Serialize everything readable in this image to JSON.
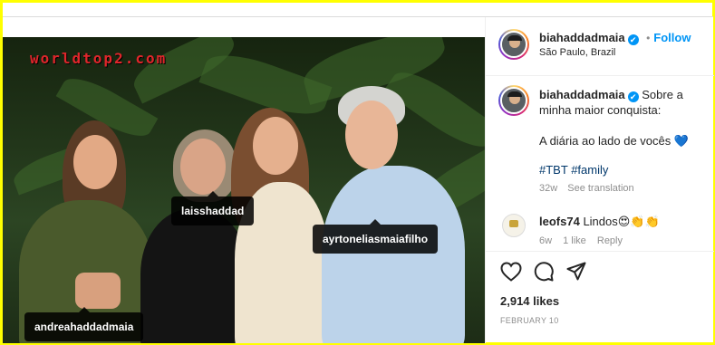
{
  "watermark": "worldtop2.com",
  "photo_tags": [
    {
      "name": "laisshaddad"
    },
    {
      "name": "ayrtoneliasmaiafilho"
    },
    {
      "name": "andreahaddadmaia"
    }
  ],
  "header": {
    "username": "biahaddadmaia",
    "verified_mark": "✔",
    "dot": "•",
    "follow_label": "Follow",
    "location": "São Paulo, Brazil"
  },
  "caption": {
    "username": "biahaddadmaia",
    "line1": "Sobre a minha maior conquista:",
    "line2": "A diária ao lado de vocês",
    "heart": "💙",
    "hashtags": [
      "#TBT",
      "#family"
    ],
    "age": "32w",
    "see_translation": "See translation"
  },
  "comment": {
    "username": "leofs74",
    "text": "Lindos",
    "emojis": "😍👏👏",
    "age": "6w",
    "likes": "1 like",
    "reply": "Reply"
  },
  "actions": {
    "like_icon": "heart-outline-icon",
    "comment_icon": "comment-bubble-icon",
    "share_icon": "paper-plane-icon"
  },
  "likes_count": "2,914 likes",
  "post_date": "FEBRUARY 10"
}
